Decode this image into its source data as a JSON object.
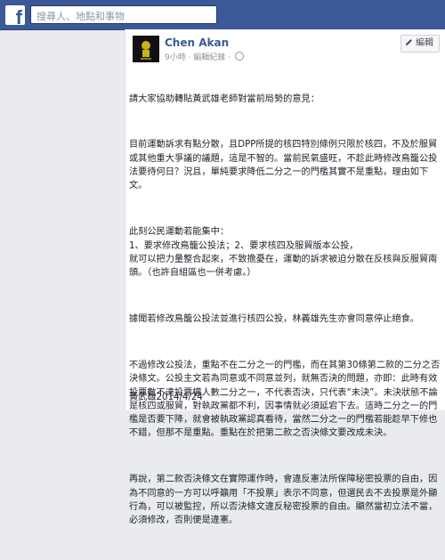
{
  "header": {
    "logo_letter": "f",
    "search_placeholder": "搜尋人、地點和事物"
  },
  "post": {
    "author": "Chen Akan",
    "meta": "9小時 · 編輯紀錄 ·",
    "edit_button_label": "編輯",
    "paragraphs": [
      "請大家協助轉貼黃武雄老師對當前局勢的意見：",
      "目前運動訴求有點分散，且DPP所提的核四特別條例只限於核四，不及於服貿或其他重大爭議的議題，這是不智的。當前民氣盛旺，不趁此時修改鳥籠公投法要待何日？況且，單純要求降低二分之一的門檻其實不是重點，理由如下文。",
      "此刻公民運動若能集中：\n1、要求修改鳥籠公投法；2、要求核四及服貿版本公投，\n就可以把力量整合起來，不致擔憂在，運動的訴求被迫分散在反核與反服貿兩頭。（也許自組區也一併考慮。）",
      "據聞若修改鳥籠公投法並進行核四公投，林義雄先生亦會同意停止絕食。",
      "不過修改公投法，重點不在二分之一的門檻，而在其第30條第二款的二分之否決條文。公投主文若為同意或不同意並列，就無否決的問題，亦即：此時有效投票數不達投票權人數二分之一，不代表否決，只代表“未決”。未決狀態不論是核四或服貿，對執政黨都不利，因事情就必須延宕下去。這時二分之一的門檻是否要下降，就會被執政黨認真看待，當然二分之一的門檻若能趁早下修也不錯，但那不是重點。重點在於把第二款之否決條文要改成未決。",
      "再說，第二款否決條文在實際運作時，會違反憲法所保障秘密投票的自由，因為不同意的一方可以呼籲用「不投票」表示不同意，但選民去不去投票是外顯行為，可以被監控，所以否決條文違反秘密投票的自由。顯然當初立法不當，必須修改，否則便是違憲。"
    ],
    "signature": "黃武雄2014/4/24"
  }
}
